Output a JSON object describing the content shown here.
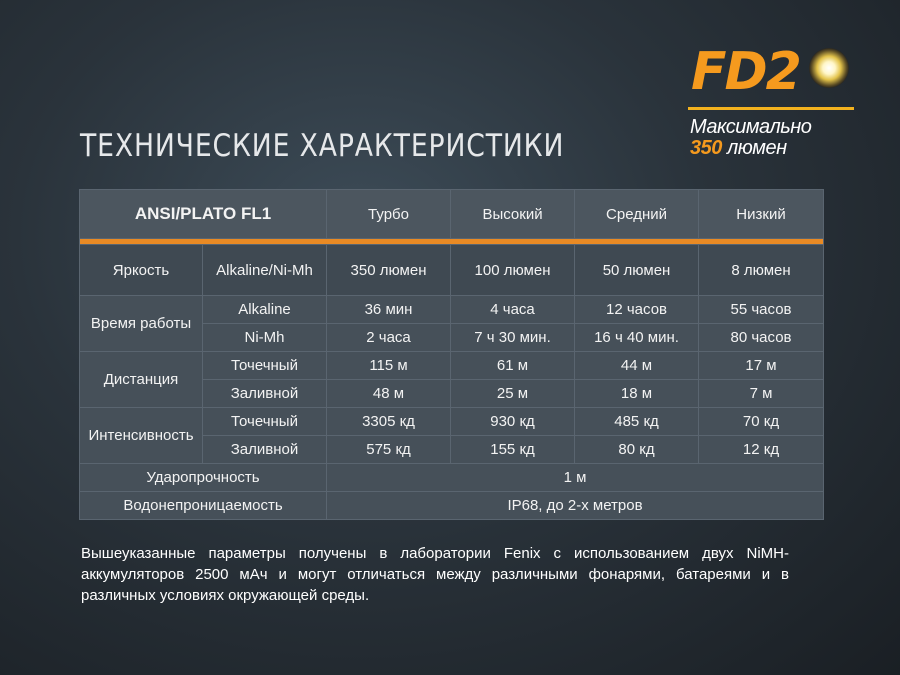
{
  "title": "ТЕХНИЧЕСКИЕ ХАРАКТЕРИСТИКИ",
  "brand": {
    "model": "FD2",
    "max_label": "Максимально",
    "max_value": "350",
    "max_unit": "люмен",
    "accent_color": "#f59a1e",
    "icon": "flashlight-lens-icon"
  },
  "table": {
    "header": {
      "standard": "ANSI/PLATO FL1",
      "modes": [
        "Турбо",
        "Высокий",
        "Средний",
        "Низкий"
      ]
    },
    "brightness": {
      "label": "Яркость",
      "battery": "Alkaline/Ni-Mh",
      "values": [
        "350 люмен",
        "100 люмен",
        "50 люмен",
        "8 люмен"
      ]
    },
    "runtime": {
      "label": "Время работы",
      "rows": [
        {
          "sub": "Alkaline",
          "values": [
            "36 мин",
            "4 часа",
            "12 часов",
            "55 часов"
          ]
        },
        {
          "sub": "Ni-Mh",
          "values": [
            "2 часа",
            "7 ч 30 мин.",
            "16 ч 40 мин.",
            "80 часов"
          ]
        }
      ]
    },
    "distance": {
      "label": "Дистанция",
      "rows": [
        {
          "sub": "Точечный",
          "values": [
            "115 м",
            "61 м",
            "44 м",
            "17 м"
          ]
        },
        {
          "sub": "Заливной",
          "values": [
            "48 м",
            "25 м",
            "18 м",
            "7 м"
          ]
        }
      ]
    },
    "intensity": {
      "label": "Интенсивность",
      "rows": [
        {
          "sub": "Точечный",
          "values": [
            "3305 кд",
            "930 кд",
            "485 кд",
            "70 кд"
          ]
        },
        {
          "sub": "Заливной",
          "values": [
            "575 кд",
            "155 кд",
            "80 кд",
            "12 кд"
          ]
        }
      ]
    },
    "impact": {
      "label": "Ударопрочность",
      "value": "1 м"
    },
    "waterproof": {
      "label": "Водонепроницаемость",
      "value": "IP68, до 2-х метров"
    }
  },
  "note": "Вышеуказанные параметры получены в лаборатории Fenix с использованием двух NiMH-аккумуляторов 2500 мАч и могут отличаться между различными фонарями, батареями и в различных условиях окружающей среды."
}
